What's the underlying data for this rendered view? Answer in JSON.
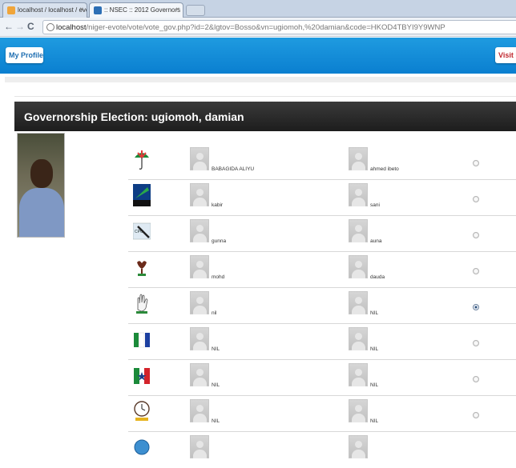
{
  "browser": {
    "tabs": [
      {
        "label": "localhost / localhost / evot",
        "active": false
      },
      {
        "label": ":: NSEC :: 2012 Governors",
        "active": true
      }
    ],
    "url_host": "localhost",
    "url_path": "/niger-evote/vote/vote_gov.php?id=2&lgtov=Bosso&vn=ugiomoh,%20damian&code=HKOD4TBYI9Y9WNP"
  },
  "appbar": {
    "my_profile_label": "My Profile",
    "visit_label": "Visit N",
    "accent": "#0a7fd0"
  },
  "election": {
    "prefix": "Governorship Election: ",
    "voter": "ugiomoh, damian"
  },
  "ballot": {
    "rows": [
      {
        "party_logo": "umbrella-party-logo",
        "candidate1": "BABAGIDA ALIYU",
        "candidate2": "ahmed ibeto",
        "selected": false
      },
      {
        "party_logo": "acn-party-logo",
        "candidate1": "kabir",
        "candidate2": "sani",
        "selected": false
      },
      {
        "party_logo": "cpc-party-logo",
        "candidate1": "gunna",
        "candidate2": "auna",
        "selected": false
      },
      {
        "party_logo": "rooster-party-logo",
        "candidate1": "mohd",
        "candidate2": "dauda",
        "selected": false
      },
      {
        "party_logo": "hand-party-logo",
        "candidate1": "nil",
        "candidate2": "NIL",
        "selected": true
      },
      {
        "party_logo": "flag-party-logo",
        "candidate1": "NIL",
        "candidate2": "NIL",
        "selected": false
      },
      {
        "party_logo": "star-flag-party-logo",
        "candidate1": "NIL",
        "candidate2": "NIL",
        "selected": false
      },
      {
        "party_logo": "clock-fresh-party-logo",
        "candidate1": "NIL",
        "candidate2": "NIL",
        "selected": false
      },
      {
        "party_logo": "seal-party-logo",
        "candidate1": "",
        "candidate2": "",
        "selected": false
      }
    ]
  }
}
